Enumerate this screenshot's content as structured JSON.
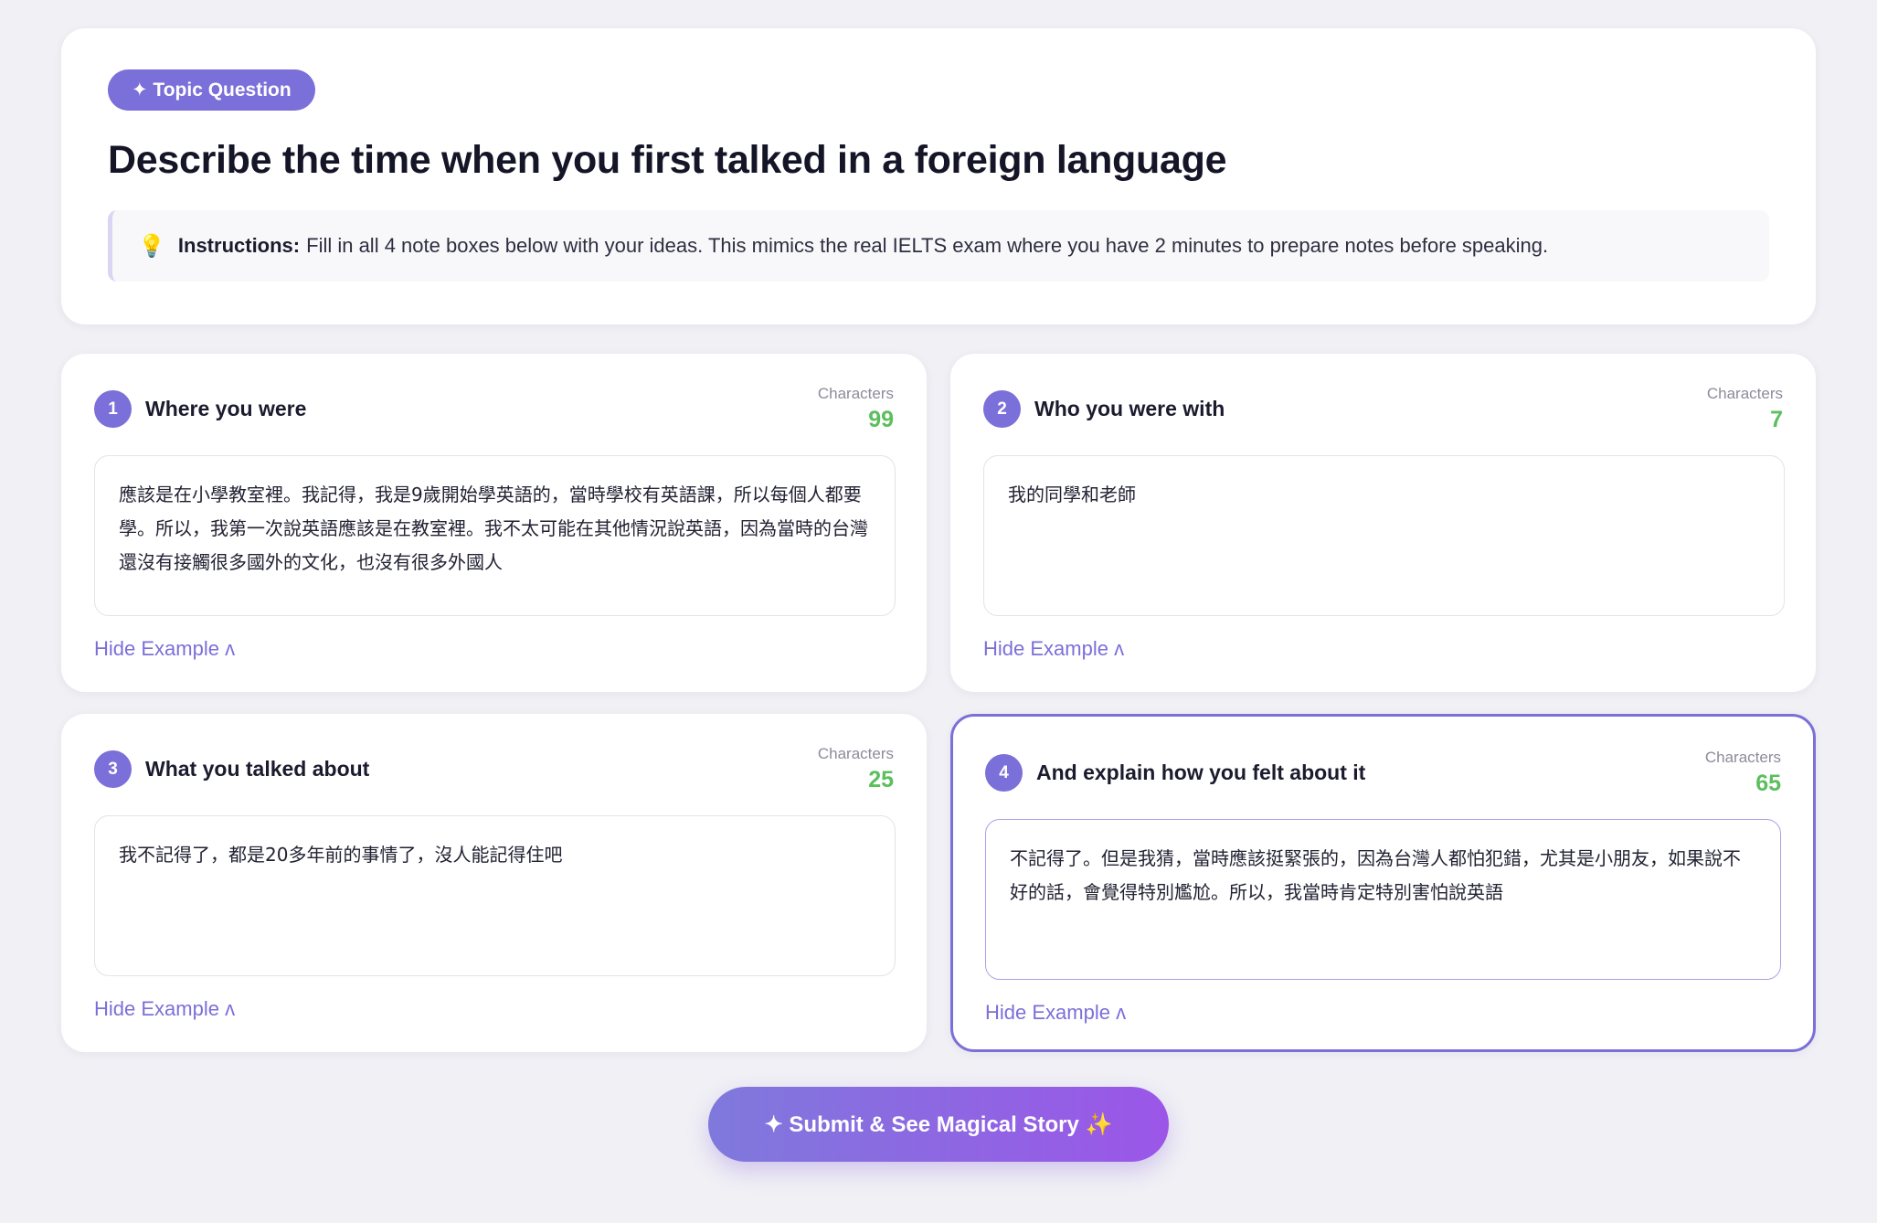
{
  "header": {
    "badge": "✦ Topic Question",
    "title": "Describe the time when you first talked in a foreign language",
    "instructions_bold": "Instructions:",
    "instructions_text": "Fill in all 4 note boxes below with your ideas. This mimics the real IELTS exam where you have 2 minutes to prepare notes before speaking.",
    "instructions_icon": "lightbulb-icon"
  },
  "notes": [
    {
      "number": "1",
      "label": "Where you were",
      "char_label": "Characters",
      "char_count": "99",
      "text": "應該是在小學教室裡。我記得，我是9歲開始學英語的，當時學校有英語課，所以每個人都要學。所以，我第一次說英語應該是在教室裡。我不太可能在其他情況說英語，因為當時的台灣還沒有接觸很多國外的文化，也沒有很多外國人",
      "toggle": "Hide Example ʌ"
    },
    {
      "number": "2",
      "label": "Who you were with",
      "char_label": "Characters",
      "char_count": "7",
      "text": "我的同學和老師",
      "toggle": "Hide Example ʌ"
    },
    {
      "number": "3",
      "label": "What you talked about",
      "char_label": "Characters",
      "char_count": "25",
      "text": "我不記得了，都是20多年前的事情了，沒人能記得住吧",
      "toggle": "Hide Example ʌ"
    },
    {
      "number": "4",
      "label": "And explain how you felt about it",
      "char_label": "Characters",
      "char_count": "65",
      "text": "不記得了。但是我猜，當時應該挺緊張的，因為台灣人都怕犯錯，尤其是小朋友，如果說不好的話，會覺得特別尷尬。所以，我當時肯定特別害怕說英語",
      "toggle": "Hide Example ʌ"
    }
  ],
  "submit": {
    "label": "✦ Submit & See Magical Story ✨"
  },
  "colors": {
    "accent": "#7b6fd9",
    "count_green": "#5bbf5d",
    "background": "#f0f0f5"
  }
}
